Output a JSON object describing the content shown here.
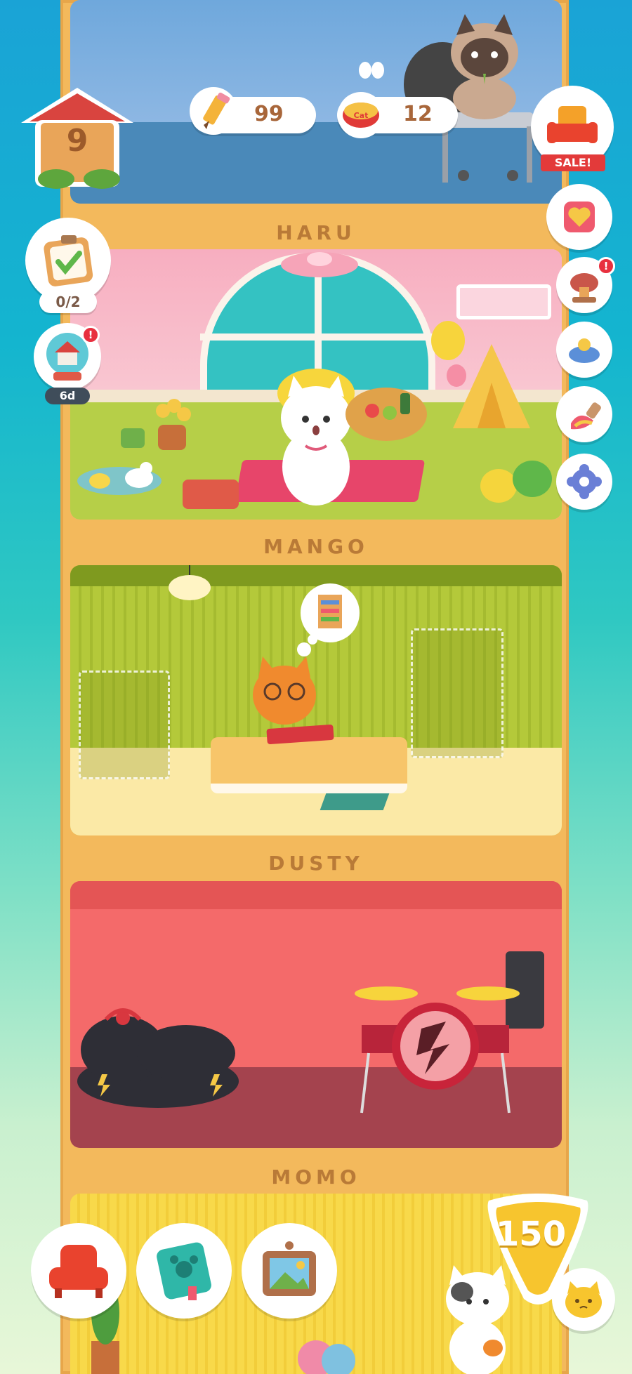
{
  "hud": {
    "house_level": "9",
    "pencils": "99",
    "cans": "12",
    "sale_label": "SALE!",
    "quest_progress": "0/2",
    "event_timer": "6d",
    "event_alert": "!",
    "stamp_alert": "!",
    "currency": "150"
  },
  "rooms": [
    {
      "name": "HARU"
    },
    {
      "name": "MANGO"
    },
    {
      "name": "DUSTY"
    },
    {
      "name": "MOMO"
    }
  ],
  "icons": {
    "house": "house-icon",
    "pencil": "pencil-icon",
    "can": "cat-food-can-icon",
    "shop": "sofa-shop-icon",
    "gift": "heart-gift-icon",
    "stamp": "stamp-icon",
    "figure": "figure-icon",
    "paint": "paint-brush-icon",
    "settings": "gear-icon",
    "armchair": "armchair-icon",
    "catbook": "cat-book-icon",
    "frame": "picture-frame-icon",
    "cat_face": "cat-face-icon"
  },
  "colors": {
    "accent": "#f3b95c",
    "red_badge": "#e8303f",
    "text_brown": "#b97a37"
  }
}
